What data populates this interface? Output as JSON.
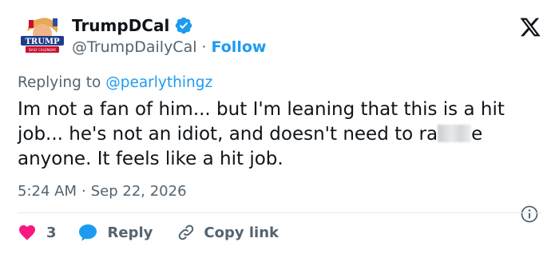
{
  "author": {
    "display_name": "TrumpDCal",
    "handle": "@TrumpDailyCal",
    "separator": "·",
    "follow_label": "Follow",
    "avatar_text": "TRUMP",
    "avatar_subtext": "DAILY CALENDAR",
    "verified": true
  },
  "reply_context": {
    "prefix": "Replying to",
    "mention": "@pearlythingz"
  },
  "tweet": {
    "text_part1": "Im not a fan of him... but I'm leaning that this is a hit job... he's not an idiot, and doesn't need to ra",
    "text_part2": "e anyone. It feels like a hit job.",
    "time": "5:24 AM",
    "separator": "·",
    "date": "Sep 22, 2026"
  },
  "actions": {
    "like_count": "3",
    "reply_label": "Reply",
    "copy_label": "Copy link"
  },
  "colors": {
    "accent": "#1d9bf0",
    "like": "#f91880",
    "muted": "#536471",
    "text": "#0f1419"
  },
  "icons": [
    "verified-badge-icon",
    "x-logo-icon",
    "info-icon",
    "heart-icon",
    "reply-bubble-icon",
    "link-icon"
  ]
}
